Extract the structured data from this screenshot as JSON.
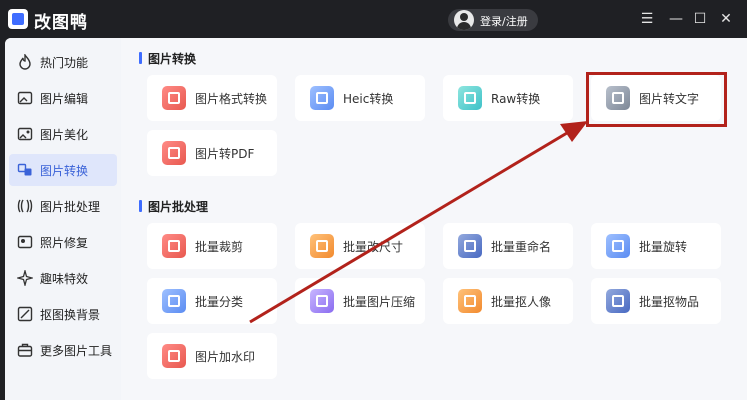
{
  "app": {
    "title": "改图鸭",
    "login_label": "登录/注册"
  },
  "sidebar": {
    "items": [
      {
        "label": "热门功能",
        "icon": "flame-icon"
      },
      {
        "label": "图片编辑",
        "icon": "image-edit-icon"
      },
      {
        "label": "图片美化",
        "icon": "image-beautify-icon"
      },
      {
        "label": "图片转换",
        "icon": "image-convert-icon",
        "active": true
      },
      {
        "label": "图片批处理",
        "icon": "batch-icon"
      },
      {
        "label": "照片修复",
        "icon": "photo-repair-icon"
      },
      {
        "label": "趣味特效",
        "icon": "effects-icon"
      },
      {
        "label": "抠图换背景",
        "icon": "cutout-icon"
      },
      {
        "label": "更多图片工具",
        "icon": "toolbox-icon"
      }
    ]
  },
  "sections": {
    "convert": {
      "title": "图片转换",
      "cards": [
        {
          "label": "图片格式转换"
        },
        {
          "label": "Heic转换"
        },
        {
          "label": "Raw转换"
        },
        {
          "label": "图片转文字"
        },
        {
          "label": "图片转PDF"
        }
      ]
    },
    "batch": {
      "title": "图片批处理",
      "cards": [
        {
          "label": "批量裁剪"
        },
        {
          "label": "批量改尺寸"
        },
        {
          "label": "批量重命名"
        },
        {
          "label": "批量旋转"
        },
        {
          "label": "批量分类"
        },
        {
          "label": "批量图片压缩"
        },
        {
          "label": "批量抠人像"
        },
        {
          "label": "批量抠物品"
        },
        {
          "label": "图片加水印"
        }
      ]
    }
  },
  "colors": {
    "accent": "#3f6dff",
    "annotation": "#b2221b",
    "titlebar": "#1f2024"
  }
}
